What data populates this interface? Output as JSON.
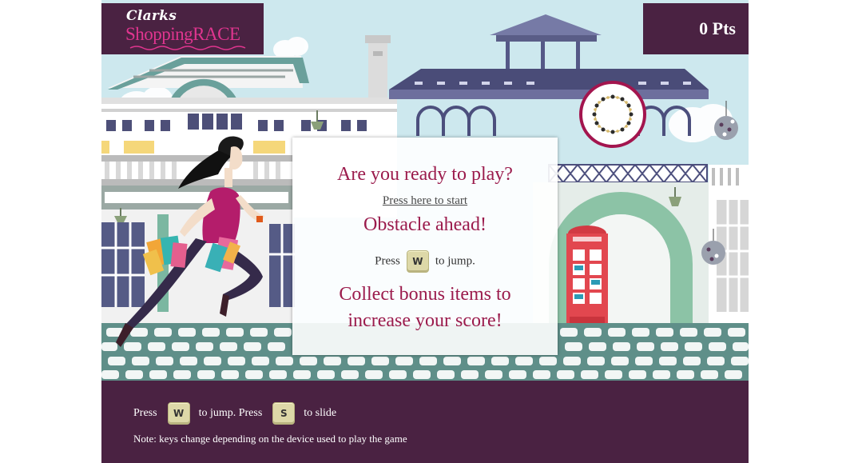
{
  "logo": {
    "brand": "Clarks",
    "game": "ShoppingRACE"
  },
  "score": {
    "text": "0 Pts"
  },
  "modal": {
    "title": "Are you ready to play?",
    "start_link": "Press here to start",
    "obstacle_heading": "Obstacle ahead!",
    "press_label": "Press",
    "jump_key": "W",
    "jump_label": "to jump.",
    "collect_line1": "Collect bonus items to",
    "collect_line2": "increase your score!"
  },
  "footer": {
    "press_label": "Press",
    "jump_key": "W",
    "jump_label": "to jump. Press",
    "slide_key": "S",
    "slide_label": "to slide",
    "note": "Note: keys change depending on the device used to play the game"
  },
  "colors": {
    "brand_purple": "#4a2242",
    "brand_pink": "#e0358f",
    "heading_red": "#9b1b4c",
    "sky": "#cde8ee",
    "street_teal": "#5b8a84",
    "phone_box_red": "#e2474f"
  },
  "icons": [
    "runner-character",
    "necklace-bonus-icon",
    "phone-box-obstacle",
    "hanging-lamp-icon"
  ]
}
